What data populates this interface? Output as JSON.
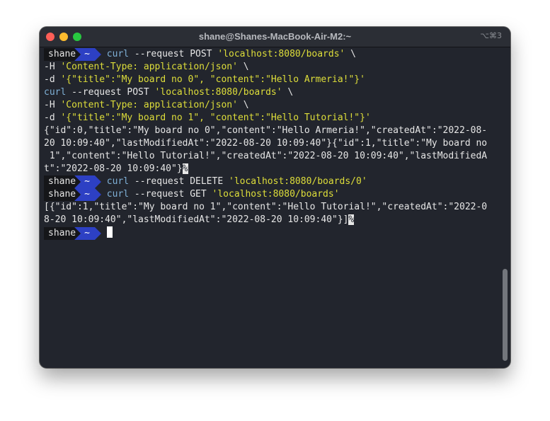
{
  "window": {
    "title": "shane@Shanes-MacBook-Air-M2:~",
    "shortcut": "⌥⌘3"
  },
  "prompt": {
    "user": "shane",
    "dir": "~"
  },
  "terminal": {
    "cmd1": {
      "curl": "curl",
      "args": " --request POST ",
      "url": "'localhost:8080/boards'",
      "cont": " \\",
      "h_flag": "-H ",
      "h_val": "'Content-Type: application/json'",
      "h_cont": " \\",
      "d_flag": "-d ",
      "d_val": "'{\"title\":\"My board no 0\", \"content\":\"Hello Armeria!\"}'"
    },
    "cmd2": {
      "curl": "curl",
      "args": " --request POST ",
      "url": "'localhost:8080/boards'",
      "cont": " \\",
      "h_flag": "-H ",
      "h_val": "'Content-Type: application/json'",
      "h_cont": " \\",
      "d_flag": "-d ",
      "d_val": "'{\"title\":\"My board no 1\", \"content\":\"Hello Tutorial!\"}'"
    },
    "output1": "{\"id\":0,\"title\":\"My board no 0\",\"content\":\"Hello Armeria!\",\"createdAt\":\"2022-08-\n20 10:09:40\",\"lastModifiedAt\":\"2022-08-20 10:09:40\"}{\"id\":1,\"title\":\"My board no\n 1\",\"content\":\"Hello Tutorial!\",\"createdAt\":\"2022-08-20 10:09:40\",\"lastModifiedA\nt\":\"2022-08-20 10:09:40\"}",
    "end_marker": "%",
    "cmd3": {
      "curl": "curl",
      "args": " --request DELETE ",
      "url": "'localhost:8080/boards/0'"
    },
    "cmd4": {
      "curl": "curl",
      "args": " --request GET ",
      "url": "'localhost:8080/boards'"
    },
    "output2": "[{\"id\":1,\"title\":\"My board no 1\",\"content\":\"Hello Tutorial!\",\"createdAt\":\"2022-0\n8-20 10:09:40\",\"lastModifiedAt\":\"2022-08-20 10:09:40\"}]"
  },
  "colors": {
    "background": "#22252d",
    "command": "#7fb0d6",
    "string": "#dede3a",
    "prompt_dir": "#2d40c4"
  }
}
